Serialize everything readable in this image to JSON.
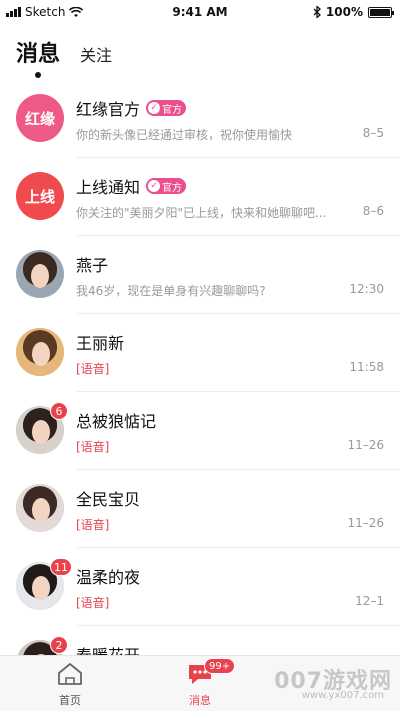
{
  "status_bar": {
    "carrier": "Sketch",
    "time": "9:41 AM",
    "battery_text": "100%"
  },
  "header": {
    "tabs": [
      {
        "label": "消息",
        "active": true
      },
      {
        "label": "关注",
        "active": false
      }
    ]
  },
  "conversations": [
    {
      "name": "红缘官方",
      "avatar_text": "红缘",
      "avatar_color": "#ee5a86",
      "official": true,
      "official_label": "官方",
      "message": "你的新头像已经通过审核，祝你使用愉快",
      "time": "8–5",
      "voice": false,
      "badge": ""
    },
    {
      "name": "上线通知",
      "avatar_text": "上线",
      "avatar_color": "#ef4b4f",
      "official": true,
      "official_label": "官方",
      "message": "你关注的\"美丽夕阳\"已上线，快来和她聊聊吧...",
      "time": "8–6",
      "voice": false,
      "badge": ""
    },
    {
      "name": "燕子",
      "avatar_text": "",
      "official": false,
      "message": "我46岁，现在是单身有兴趣聊聊吗?",
      "time": "12:30",
      "voice": false,
      "badge": ""
    },
    {
      "name": "王丽新",
      "avatar_text": "",
      "official": false,
      "message": "[语音]",
      "time": "11:58",
      "voice": true,
      "badge": ""
    },
    {
      "name": "总被狼惦记",
      "avatar_text": "",
      "official": false,
      "message": "[语音]",
      "time": "11–26",
      "voice": true,
      "badge": "6"
    },
    {
      "name": "全民宝贝",
      "avatar_text": "",
      "official": false,
      "message": "[语音]",
      "time": "11–26",
      "voice": true,
      "badge": ""
    },
    {
      "name": "温柔的夜",
      "avatar_text": "",
      "official": false,
      "message": "[语音]",
      "time": "12–1",
      "voice": true,
      "badge": "11"
    },
    {
      "name": "春暖花开",
      "avatar_text": "",
      "official": false,
      "message": "",
      "time": "",
      "voice": false,
      "badge": "2"
    }
  ],
  "tabbar": {
    "home_label": "首页",
    "messages_label": "消息",
    "messages_badge": "99+"
  },
  "watermark": {
    "main": "007游戏网",
    "sub": "www.yx007.com"
  },
  "colors": {
    "accent": "#e8424c",
    "official_badge": "#ec4f8d"
  }
}
